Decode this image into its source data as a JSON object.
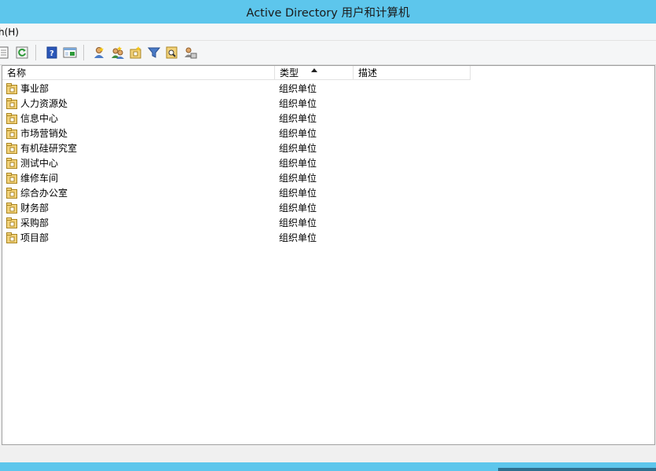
{
  "window": {
    "title": "Active Directory 用户和计算机"
  },
  "menubar": {
    "items": [
      {
        "label": "h(H)"
      }
    ]
  },
  "colors": {
    "titlebar": "#5dc6ec",
    "accent": "#5dc6ec"
  },
  "toolbar": {
    "buttons": [
      {
        "icon": "properties-icon"
      },
      {
        "icon": "refresh-icon"
      },
      {
        "icon": "help-icon"
      },
      {
        "icon": "show-console-tree-icon"
      },
      {
        "icon": "new-user-icon"
      },
      {
        "icon": "new-group-icon"
      },
      {
        "icon": "new-ou-icon"
      },
      {
        "icon": "filter-icon"
      },
      {
        "icon": "find-icon"
      },
      {
        "icon": "add-to-group-icon"
      }
    ]
  },
  "list": {
    "columns": [
      {
        "label": "名称"
      },
      {
        "label": "类型"
      },
      {
        "label": "描述"
      }
    ],
    "sort": {
      "column": "类型",
      "direction": "ascending"
    },
    "rows": [
      {
        "name": "事业部",
        "type": "组织单位",
        "desc": ""
      },
      {
        "name": "人力资源处",
        "type": "组织单位",
        "desc": ""
      },
      {
        "name": "信息中心",
        "type": "组织单位",
        "desc": ""
      },
      {
        "name": "市场营销处",
        "type": "组织单位",
        "desc": ""
      },
      {
        "name": "有机硅研究室",
        "type": "组织单位",
        "desc": ""
      },
      {
        "name": "测试中心",
        "type": "组织单位",
        "desc": ""
      },
      {
        "name": "维修车间",
        "type": "组织单位",
        "desc": ""
      },
      {
        "name": "综合办公室",
        "type": "组织单位",
        "desc": ""
      },
      {
        "name": "财务部",
        "type": "组织单位",
        "desc": ""
      },
      {
        "name": "采购部",
        "type": "组织单位",
        "desc": ""
      },
      {
        "name": "项目部",
        "type": "组织单位",
        "desc": ""
      }
    ]
  }
}
